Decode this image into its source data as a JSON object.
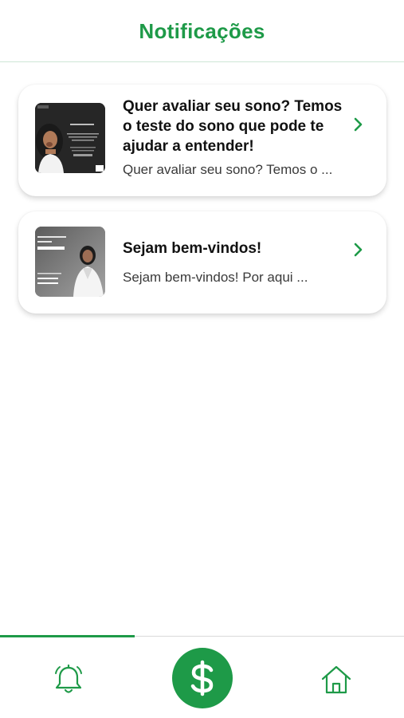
{
  "header": {
    "title": "Notificações"
  },
  "notifications": [
    {
      "title": "Quer avaliar seu sono? Temos o teste do sono que pode te ajudar a entender!",
      "preview": "Quer avaliar seu sono? Temos o ...",
      "thumbnail_icon": "sleep-woman-yawning-image"
    },
    {
      "title": "Sejam bem-vindos!",
      "preview": "Sejam bem-vindos! Por aqui ...",
      "thumbnail_icon": "doctor-welcome-image",
      "thumbnail_text": [
        "SEJAM BEM-VINDOS",
        "AO APP DA",
        "DRª AMANDA",
        "• PROMOÇÃO",
        "• VITALIDADE"
      ]
    }
  ],
  "tabbar": {
    "tabs": [
      {
        "icon": "bell-icon",
        "active": true
      },
      {
        "icon": "dollar-icon",
        "active": false
      },
      {
        "icon": "home-icon",
        "active": false
      }
    ]
  },
  "colors": {
    "accent": "#1e9a48",
    "text": "#111111",
    "muted": "#3a3a3a"
  }
}
